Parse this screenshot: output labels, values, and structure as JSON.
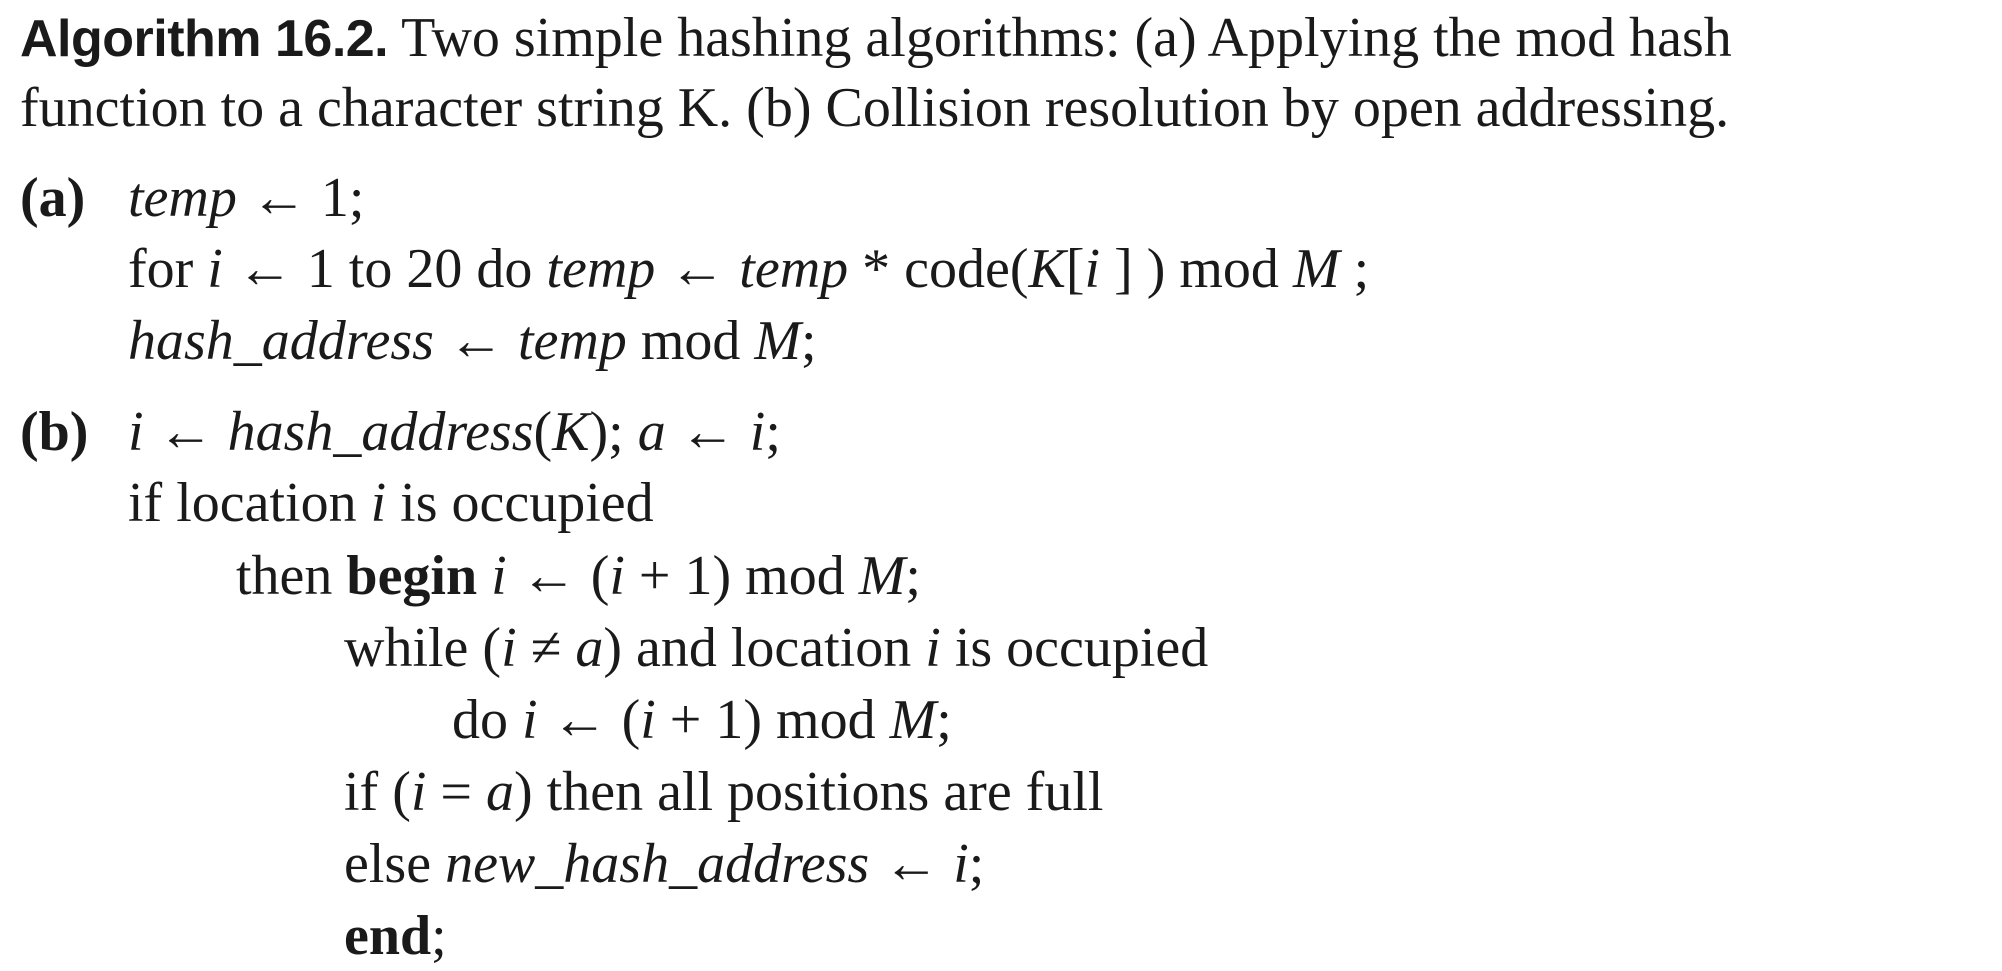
{
  "caption": {
    "title": "Algorithm 16.2.",
    "line1_rest": "Two simple hashing algorithms: (a) Applying the mod hash",
    "line2": "function to a character string K. (b) Collision resolution by open addressing."
  },
  "part_a": {
    "label": "(a)",
    "lines": [
      [
        {
          "t": "temp",
          "s": "i"
        },
        {
          "t": " ← 1;",
          "s": ""
        }
      ],
      [
        {
          "t": "for ",
          "s": ""
        },
        {
          "t": "i",
          "s": "i"
        },
        {
          "t": " ← 1 to 20 do ",
          "s": ""
        },
        {
          "t": "temp",
          "s": "i"
        },
        {
          "t": " ← ",
          "s": ""
        },
        {
          "t": "temp",
          "s": "i"
        },
        {
          "t": " * code(",
          "s": ""
        },
        {
          "t": "K",
          "s": "i"
        },
        {
          "t": "[",
          "s": ""
        },
        {
          "t": "i",
          "s": "i"
        },
        {
          "t": " ] ) mod ",
          "s": ""
        },
        {
          "t": "M",
          "s": "i"
        },
        {
          "t": " ;",
          "s": ""
        }
      ],
      [
        {
          "t": "hash_address",
          "s": "i"
        },
        {
          "t": " ← ",
          "s": ""
        },
        {
          "t": "temp",
          "s": "i"
        },
        {
          "t": " mod ",
          "s": ""
        },
        {
          "t": "M",
          "s": "i"
        },
        {
          "t": ";",
          "s": ""
        }
      ]
    ]
  },
  "part_b": {
    "label": "(b)",
    "lines": [
      [
        {
          "t": "i",
          "s": "i"
        },
        {
          "t": " ← ",
          "s": ""
        },
        {
          "t": "hash_address",
          "s": "i"
        },
        {
          "t": "(",
          "s": ""
        },
        {
          "t": "K",
          "s": "i"
        },
        {
          "t": "); ",
          "s": ""
        },
        {
          "t": "a",
          "s": "i"
        },
        {
          "t": " ← ",
          "s": ""
        },
        {
          "t": "i",
          "s": "i"
        },
        {
          "t": ";",
          "s": ""
        }
      ],
      [
        {
          "t": "if location ",
          "s": ""
        },
        {
          "t": "i",
          "s": "i"
        },
        {
          "t": " is occupied",
          "s": ""
        }
      ],
      [
        {
          "t": "then ",
          "s": ""
        },
        {
          "t": "begin",
          "s": "b"
        },
        {
          "t": " ",
          "s": ""
        },
        {
          "t": "i",
          "s": "i"
        },
        {
          "t": " ← (",
          "s": ""
        },
        {
          "t": "i",
          "s": "i"
        },
        {
          "t": " + 1) mod ",
          "s": ""
        },
        {
          "t": "M",
          "s": "i"
        },
        {
          "t": ";",
          "s": ""
        }
      ],
      [
        {
          "t": "while (",
          "s": ""
        },
        {
          "t": "i",
          "s": "i"
        },
        {
          "t": " ≠ ",
          "s": ""
        },
        {
          "t": "a",
          "s": "i"
        },
        {
          "t": ") and location ",
          "s": ""
        },
        {
          "t": "i",
          "s": "i"
        },
        {
          "t": " is occupied",
          "s": ""
        }
      ],
      [
        {
          "t": "do ",
          "s": ""
        },
        {
          "t": "i",
          "s": "i"
        },
        {
          "t": " ← (",
          "s": ""
        },
        {
          "t": "i",
          "s": "i"
        },
        {
          "t": " + 1) mod ",
          "s": ""
        },
        {
          "t": "M",
          "s": "i"
        },
        {
          "t": ";",
          "s": ""
        }
      ],
      [
        {
          "t": "if (",
          "s": ""
        },
        {
          "t": "i",
          "s": "i"
        },
        {
          "t": " = ",
          "s": ""
        },
        {
          "t": "a",
          "s": "i"
        },
        {
          "t": ") then all positions are full",
          "s": ""
        }
      ],
      [
        {
          "t": "else ",
          "s": ""
        },
        {
          "t": "new_hash_address",
          "s": "i"
        },
        {
          "t": " ← ",
          "s": ""
        },
        {
          "t": "i",
          "s": "i"
        },
        {
          "t": ";",
          "s": ""
        }
      ],
      [
        {
          "t": "end",
          "s": "b"
        },
        {
          "t": ";",
          "s": ""
        }
      ]
    ]
  }
}
